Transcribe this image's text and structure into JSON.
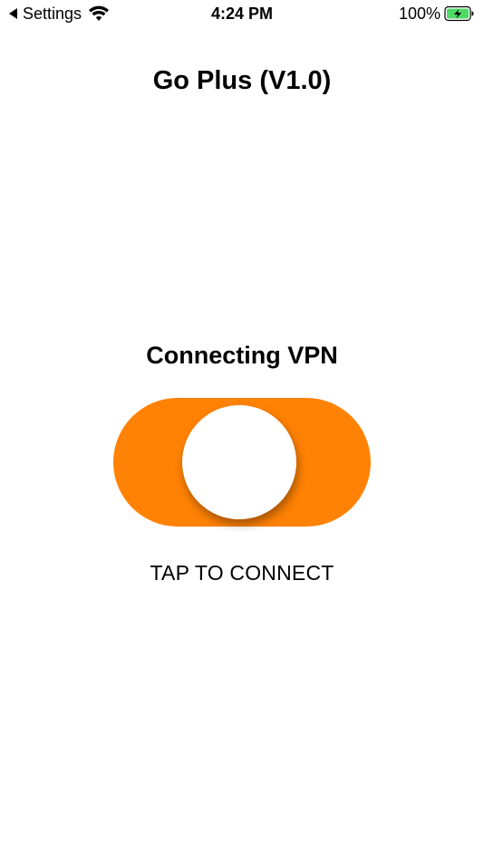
{
  "status_bar": {
    "back_label": "Settings",
    "time": "4:24 PM",
    "battery_percent": "100%",
    "battery_color": "#4CD964"
  },
  "app": {
    "title": "Go Plus (V1.0)"
  },
  "vpn": {
    "status_text": "Connecting VPN",
    "toggle_color": "#FF8204",
    "tap_label": "TAP TO CONNECT"
  }
}
